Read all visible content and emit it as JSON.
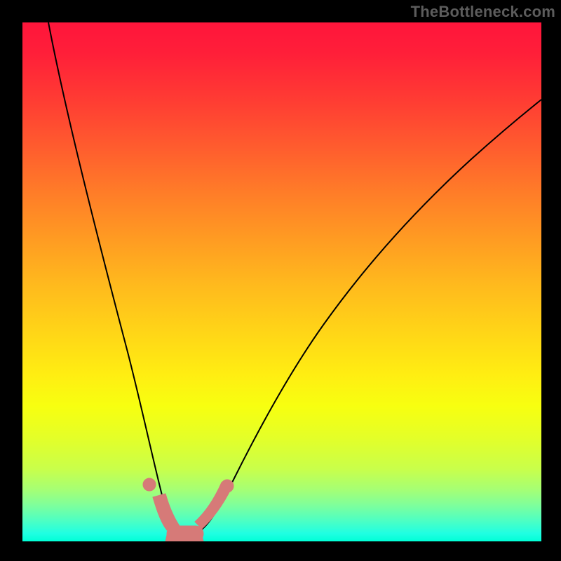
{
  "watermark": "TheBottleneck.com",
  "chart_data": {
    "type": "line",
    "title": "",
    "xlabel": "",
    "ylabel": "",
    "xlim": [
      0,
      1
    ],
    "ylim": [
      0,
      1
    ],
    "grid": false,
    "legend": false,
    "background": "vertical-gradient red→green",
    "series": [
      {
        "name": "bottleneck-curve",
        "x": [
          0.05,
          0.1,
          0.15,
          0.2,
          0.23,
          0.26,
          0.28,
          0.3,
          0.33,
          0.36,
          0.4,
          0.45,
          0.5,
          0.57,
          0.65,
          0.75,
          0.86,
          0.98
        ],
        "y": [
          1.0,
          0.8,
          0.58,
          0.36,
          0.22,
          0.1,
          0.04,
          0.02,
          0.02,
          0.04,
          0.1,
          0.2,
          0.31,
          0.44,
          0.56,
          0.68,
          0.78,
          0.85
        ]
      }
    ],
    "markers": [
      {
        "name": "marker-left-dot",
        "x": 0.245,
        "y": 0.11,
        "r": 0.012,
        "color": "#d67a78"
      },
      {
        "name": "marker-left-stroke",
        "kind": "thick-segment",
        "x0": 0.252,
        "y0": 0.085,
        "x1": 0.275,
        "y1": 0.024,
        "w": 0.03,
        "color": "#d67a78"
      },
      {
        "name": "marker-trough",
        "kind": "thick-segment",
        "x0": 0.282,
        "y0": 0.02,
        "x1": 0.345,
        "y1": 0.02,
        "w": 0.03,
        "color": "#d67a78"
      },
      {
        "name": "marker-right-stroke",
        "kind": "thick-segment",
        "x0": 0.352,
        "y0": 0.028,
        "x1": 0.4,
        "y1": 0.105,
        "w": 0.03,
        "color": "#d67a78"
      }
    ]
  }
}
